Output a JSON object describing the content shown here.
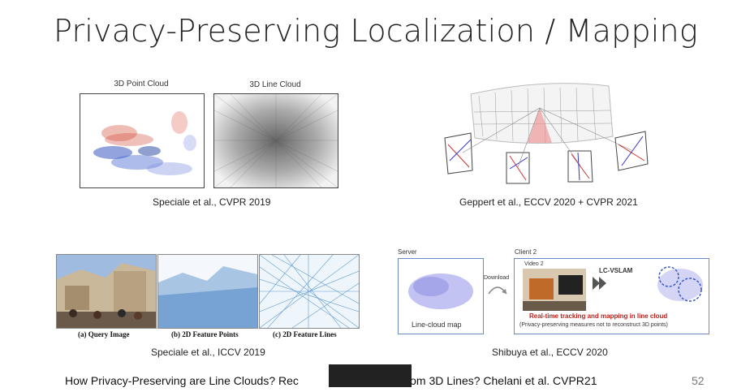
{
  "slide": {
    "title": "Privacy-Preserving Localization / Mapping",
    "page_number": "52",
    "footer": {
      "left": "How Privacy-Preserving are Line Clouds? Rec",
      "right": "Details from 3D Lines?  Chelani et al. CVPR21"
    }
  },
  "panels": {
    "p1": {
      "label_left": "3D Point Cloud",
      "label_right": "3D Line Cloud",
      "caption": "Speciale et al., CVPR 2019"
    },
    "p2": {
      "caption": "Geppert et al., ECCV 2020 + CVPR 2021"
    },
    "p3": {
      "sub_a": "(a) Query Image",
      "sub_b": "(b) 2D Feature Points",
      "sub_c": "(c) 2D Feature Lines",
      "caption": "Speciale et al., ICCV 2019"
    },
    "p4": {
      "server": "Server",
      "client": "Client 2",
      "download": "Download",
      "video": "Video 2",
      "method": "LC-VSLAM",
      "map_label": "Line-cloud map",
      "realtime": "Real-time tracking and mapping in line cloud",
      "privacy": "(Privacy-preserving measures not to reconstruct 3D points)",
      "caption": "Shibuya et al., ECCV 2020"
    }
  }
}
